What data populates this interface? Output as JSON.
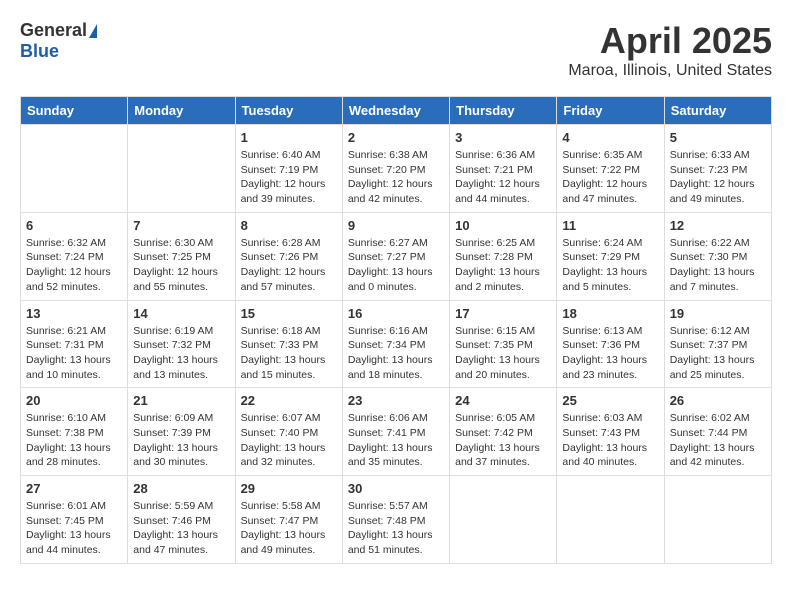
{
  "logo": {
    "general": "General",
    "blue": "Blue"
  },
  "title": "April 2025",
  "location": "Maroa, Illinois, United States",
  "weekdays": [
    "Sunday",
    "Monday",
    "Tuesday",
    "Wednesday",
    "Thursday",
    "Friday",
    "Saturday"
  ],
  "weeks": [
    [
      {
        "day": "",
        "sunrise": "",
        "sunset": "",
        "daylight": ""
      },
      {
        "day": "",
        "sunrise": "",
        "sunset": "",
        "daylight": ""
      },
      {
        "day": "1",
        "sunrise": "Sunrise: 6:40 AM",
        "sunset": "Sunset: 7:19 PM",
        "daylight": "Daylight: 12 hours and 39 minutes."
      },
      {
        "day": "2",
        "sunrise": "Sunrise: 6:38 AM",
        "sunset": "Sunset: 7:20 PM",
        "daylight": "Daylight: 12 hours and 42 minutes."
      },
      {
        "day": "3",
        "sunrise": "Sunrise: 6:36 AM",
        "sunset": "Sunset: 7:21 PM",
        "daylight": "Daylight: 12 hours and 44 minutes."
      },
      {
        "day": "4",
        "sunrise": "Sunrise: 6:35 AM",
        "sunset": "Sunset: 7:22 PM",
        "daylight": "Daylight: 12 hours and 47 minutes."
      },
      {
        "day": "5",
        "sunrise": "Sunrise: 6:33 AM",
        "sunset": "Sunset: 7:23 PM",
        "daylight": "Daylight: 12 hours and 49 minutes."
      }
    ],
    [
      {
        "day": "6",
        "sunrise": "Sunrise: 6:32 AM",
        "sunset": "Sunset: 7:24 PM",
        "daylight": "Daylight: 12 hours and 52 minutes."
      },
      {
        "day": "7",
        "sunrise": "Sunrise: 6:30 AM",
        "sunset": "Sunset: 7:25 PM",
        "daylight": "Daylight: 12 hours and 55 minutes."
      },
      {
        "day": "8",
        "sunrise": "Sunrise: 6:28 AM",
        "sunset": "Sunset: 7:26 PM",
        "daylight": "Daylight: 12 hours and 57 minutes."
      },
      {
        "day": "9",
        "sunrise": "Sunrise: 6:27 AM",
        "sunset": "Sunset: 7:27 PM",
        "daylight": "Daylight: 13 hours and 0 minutes."
      },
      {
        "day": "10",
        "sunrise": "Sunrise: 6:25 AM",
        "sunset": "Sunset: 7:28 PM",
        "daylight": "Daylight: 13 hours and 2 minutes."
      },
      {
        "day": "11",
        "sunrise": "Sunrise: 6:24 AM",
        "sunset": "Sunset: 7:29 PM",
        "daylight": "Daylight: 13 hours and 5 minutes."
      },
      {
        "day": "12",
        "sunrise": "Sunrise: 6:22 AM",
        "sunset": "Sunset: 7:30 PM",
        "daylight": "Daylight: 13 hours and 7 minutes."
      }
    ],
    [
      {
        "day": "13",
        "sunrise": "Sunrise: 6:21 AM",
        "sunset": "Sunset: 7:31 PM",
        "daylight": "Daylight: 13 hours and 10 minutes."
      },
      {
        "day": "14",
        "sunrise": "Sunrise: 6:19 AM",
        "sunset": "Sunset: 7:32 PM",
        "daylight": "Daylight: 13 hours and 13 minutes."
      },
      {
        "day": "15",
        "sunrise": "Sunrise: 6:18 AM",
        "sunset": "Sunset: 7:33 PM",
        "daylight": "Daylight: 13 hours and 15 minutes."
      },
      {
        "day": "16",
        "sunrise": "Sunrise: 6:16 AM",
        "sunset": "Sunset: 7:34 PM",
        "daylight": "Daylight: 13 hours and 18 minutes."
      },
      {
        "day": "17",
        "sunrise": "Sunrise: 6:15 AM",
        "sunset": "Sunset: 7:35 PM",
        "daylight": "Daylight: 13 hours and 20 minutes."
      },
      {
        "day": "18",
        "sunrise": "Sunrise: 6:13 AM",
        "sunset": "Sunset: 7:36 PM",
        "daylight": "Daylight: 13 hours and 23 minutes."
      },
      {
        "day": "19",
        "sunrise": "Sunrise: 6:12 AM",
        "sunset": "Sunset: 7:37 PM",
        "daylight": "Daylight: 13 hours and 25 minutes."
      }
    ],
    [
      {
        "day": "20",
        "sunrise": "Sunrise: 6:10 AM",
        "sunset": "Sunset: 7:38 PM",
        "daylight": "Daylight: 13 hours and 28 minutes."
      },
      {
        "day": "21",
        "sunrise": "Sunrise: 6:09 AM",
        "sunset": "Sunset: 7:39 PM",
        "daylight": "Daylight: 13 hours and 30 minutes."
      },
      {
        "day": "22",
        "sunrise": "Sunrise: 6:07 AM",
        "sunset": "Sunset: 7:40 PM",
        "daylight": "Daylight: 13 hours and 32 minutes."
      },
      {
        "day": "23",
        "sunrise": "Sunrise: 6:06 AM",
        "sunset": "Sunset: 7:41 PM",
        "daylight": "Daylight: 13 hours and 35 minutes."
      },
      {
        "day": "24",
        "sunrise": "Sunrise: 6:05 AM",
        "sunset": "Sunset: 7:42 PM",
        "daylight": "Daylight: 13 hours and 37 minutes."
      },
      {
        "day": "25",
        "sunrise": "Sunrise: 6:03 AM",
        "sunset": "Sunset: 7:43 PM",
        "daylight": "Daylight: 13 hours and 40 minutes."
      },
      {
        "day": "26",
        "sunrise": "Sunrise: 6:02 AM",
        "sunset": "Sunset: 7:44 PM",
        "daylight": "Daylight: 13 hours and 42 minutes."
      }
    ],
    [
      {
        "day": "27",
        "sunrise": "Sunrise: 6:01 AM",
        "sunset": "Sunset: 7:45 PM",
        "daylight": "Daylight: 13 hours and 44 minutes."
      },
      {
        "day": "28",
        "sunrise": "Sunrise: 5:59 AM",
        "sunset": "Sunset: 7:46 PM",
        "daylight": "Daylight: 13 hours and 47 minutes."
      },
      {
        "day": "29",
        "sunrise": "Sunrise: 5:58 AM",
        "sunset": "Sunset: 7:47 PM",
        "daylight": "Daylight: 13 hours and 49 minutes."
      },
      {
        "day": "30",
        "sunrise": "Sunrise: 5:57 AM",
        "sunset": "Sunset: 7:48 PM",
        "daylight": "Daylight: 13 hours and 51 minutes."
      },
      {
        "day": "",
        "sunrise": "",
        "sunset": "",
        "daylight": ""
      },
      {
        "day": "",
        "sunrise": "",
        "sunset": "",
        "daylight": ""
      },
      {
        "day": "",
        "sunrise": "",
        "sunset": "",
        "daylight": ""
      }
    ]
  ]
}
